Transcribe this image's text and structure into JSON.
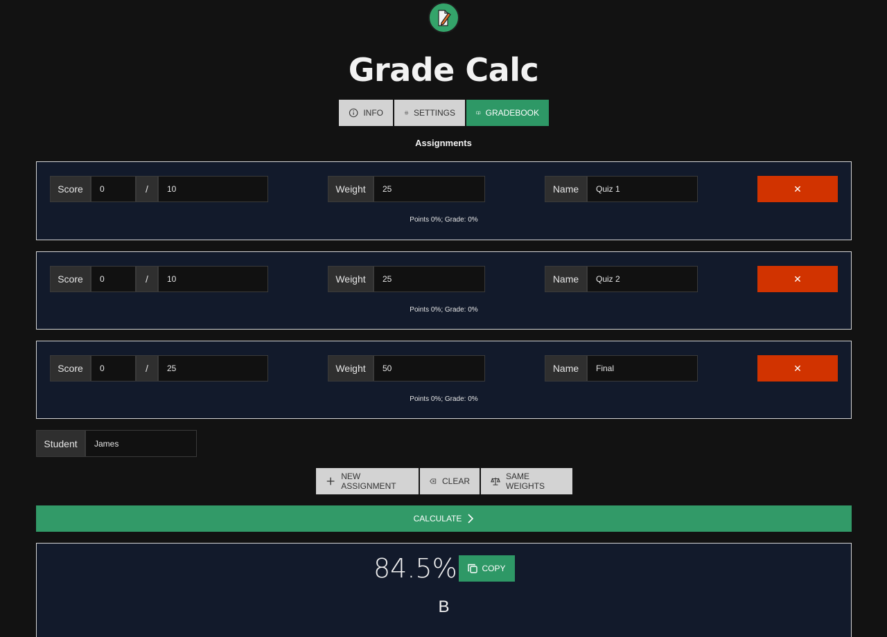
{
  "app": {
    "title": "Grade Calc"
  },
  "tabs": [
    {
      "label": "Info",
      "icon": "info-icon",
      "active": false
    },
    {
      "label": "Settings",
      "icon": "gear-icon",
      "active": false
    },
    {
      "label": "Gradebook",
      "icon": "book-icon",
      "active": true
    }
  ],
  "section_title": "Assignments",
  "labels": {
    "score": "Score",
    "slash": "/",
    "weight": "Weight",
    "name": "Name",
    "delete": "✕"
  },
  "assignments": [
    {
      "score": "0",
      "total": "10",
      "weight": "25",
      "name": "Quiz 1",
      "summary": "Points 0%; Grade: 0%"
    },
    {
      "score": "0",
      "total": "10",
      "weight": "25",
      "name": "Quiz 2",
      "summary": "Points 0%; Grade: 0%"
    },
    {
      "score": "0",
      "total": "25",
      "weight": "50",
      "name": "Final",
      "summary": "Points 0%; Grade: 0%"
    }
  ],
  "student": {
    "label": "Student",
    "value": "James"
  },
  "actions": {
    "new_assignment": "New Assignment",
    "clear": "Clear",
    "same_weights": "Same Weights"
  },
  "calculate": "Calculate",
  "result": {
    "percent": "84.5%",
    "copy": "Copy",
    "letter": "B"
  },
  "colors": {
    "accent": "#2e9866",
    "danger": "#d13300",
    "card_bg": "#121a2b",
    "page_bg": "#121212"
  }
}
